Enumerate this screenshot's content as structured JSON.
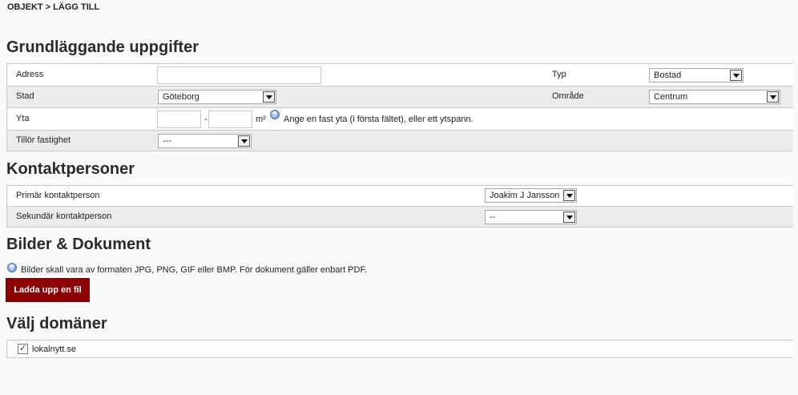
{
  "breadcrumb": "OBJEKT > LÄGG TILL",
  "sections": {
    "basic": "Grundläggande uppgifter",
    "contacts": "Kontaktpersoner",
    "media": "Bilder & Dokument",
    "domains": "Välj domäner"
  },
  "basic": {
    "address_label": "Adress",
    "address_value": "",
    "type_label": "Typ",
    "type_value": "Bostad",
    "city_label": "Stad",
    "city_value": "Göteborg",
    "area_label": "Område",
    "area_value": "Centrum",
    "size_label": "Yta",
    "size_separator": "-",
    "size_unit": "m²",
    "size_help": "Ange en fast yta (i första fältet), eller ett ytspann.",
    "property_label": "Tillör fastighet",
    "property_value": "---"
  },
  "contacts": {
    "primary_label": "Primär kontaktperson",
    "primary_value": "Joakim J Jansson",
    "secondary_label": "Sekundär kontaktperson",
    "secondary_value": "--"
  },
  "media": {
    "help": "Bilder skall vara av formaten JPG, PNG, GIF eller BMP. För dokument gäller enbart PDF.",
    "upload_label": "Ladda upp en fil"
  },
  "domains": {
    "items": [
      {
        "label": "lokalnytt.se",
        "checked": true
      }
    ]
  },
  "icons": {
    "help": "help-icon",
    "dropdown": "chevron-down-icon",
    "check": "checkmark-icon"
  },
  "colors": {
    "button": "#8b0000",
    "row_alt": "#ececec"
  }
}
